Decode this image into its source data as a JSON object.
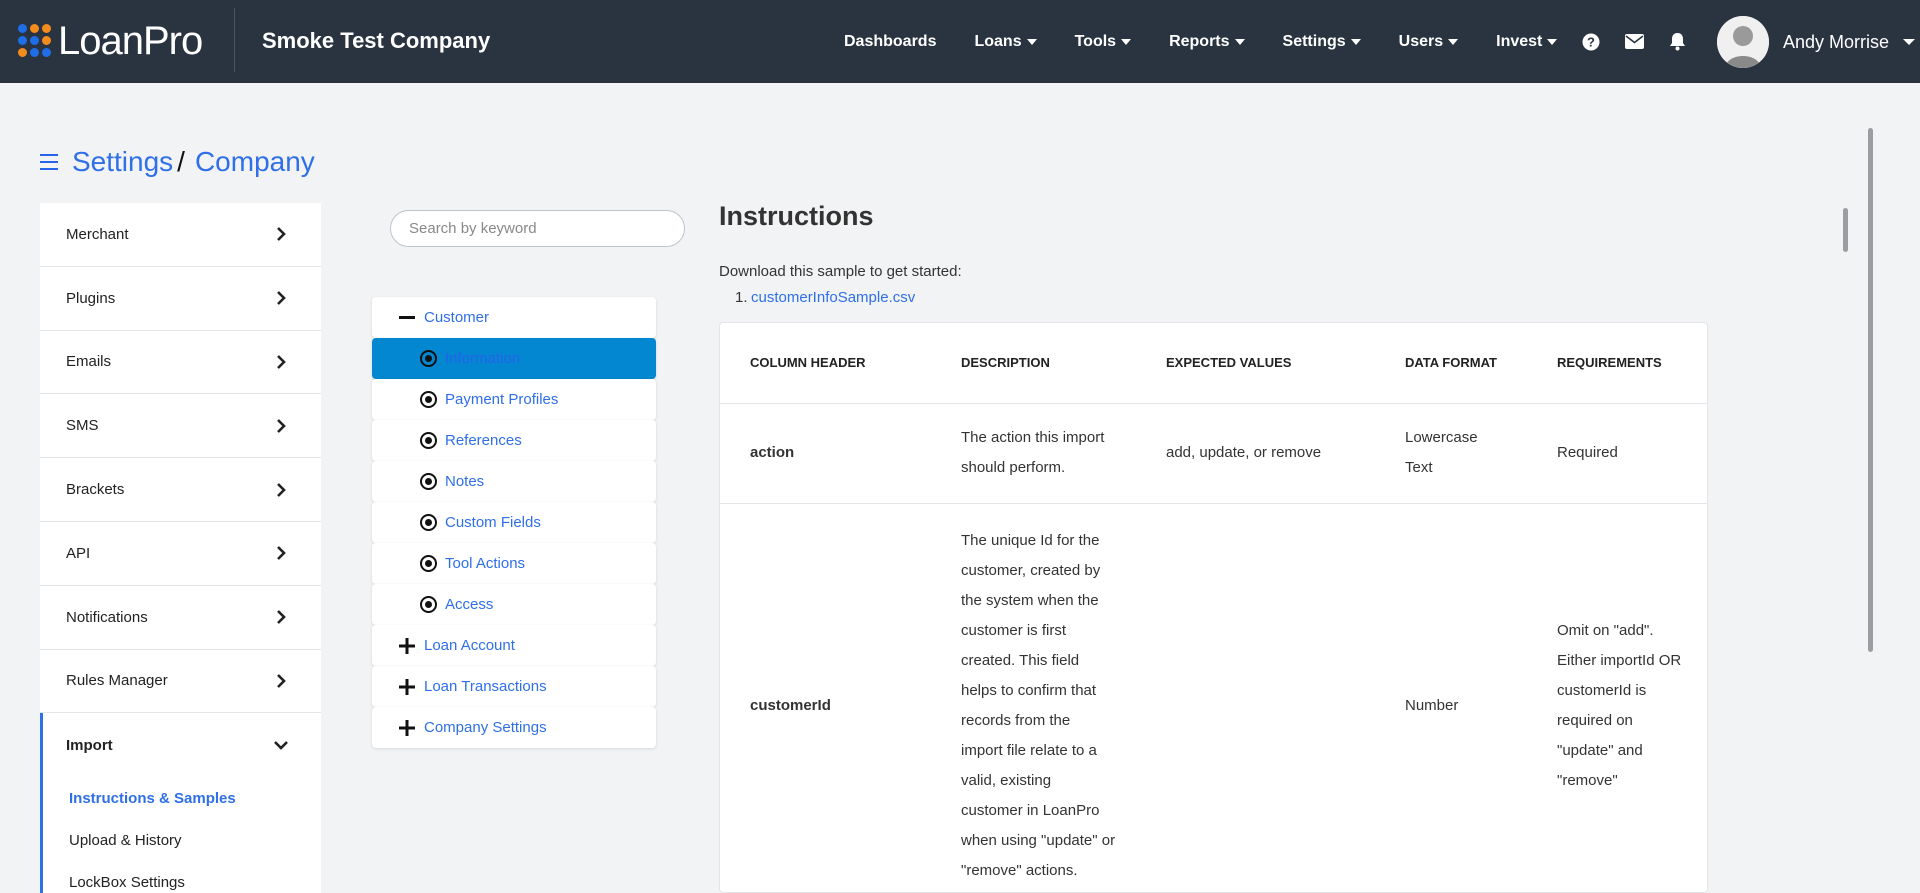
{
  "brand": {
    "logo_text": "LoanPro",
    "dot_colors": [
      "#1f6ee8",
      "#f28c1c",
      "#f28c1c",
      "#1f6ee8",
      "#1f6ee8",
      "#f28c1c",
      "#f28c1c",
      "#1f6ee8",
      "#1f6ee8"
    ],
    "company": "Smoke Test Company"
  },
  "nav": {
    "items": [
      {
        "label": "Dashboards",
        "dropdown": false
      },
      {
        "label": "Loans",
        "dropdown": true
      },
      {
        "label": "Tools",
        "dropdown": true
      },
      {
        "label": "Reports",
        "dropdown": true
      },
      {
        "label": "Settings",
        "dropdown": true
      },
      {
        "label": "Users",
        "dropdown": true
      },
      {
        "label": "Invest",
        "dropdown": true
      }
    ],
    "icons": [
      "help-icon",
      "mail-icon",
      "bell-icon"
    ],
    "user_name": "Andy Morrise"
  },
  "breadcrumb": {
    "root": "Settings",
    "separator": "/",
    "current": "Company"
  },
  "sidebar": {
    "items": [
      "Merchant",
      "Plugins",
      "Emails",
      "SMS",
      "Brackets",
      "API",
      "Notifications",
      "Rules Manager"
    ],
    "open_item": "Import",
    "sub_items": [
      "Instructions & Samples",
      "Upload & History",
      "LockBox Settings"
    ]
  },
  "search": {
    "placeholder": "Search by keyword"
  },
  "tree": {
    "customer": "Customer",
    "children": [
      "Information",
      "Payment Profiles",
      "References",
      "Notes",
      "Custom Fields",
      "Tool Actions",
      "Access"
    ],
    "collapsed": [
      "Loan Account",
      "Loan Transactions",
      "Company Settings"
    ]
  },
  "instructions": {
    "title": "Instructions",
    "intro": "Download this sample to get started:",
    "link_number": "1.",
    "link": "customerInfoSample.csv"
  },
  "table": {
    "headers": [
      "COLUMN HEADER",
      "DESCRIPTION",
      "EXPECTED VALUES",
      "DATA FORMAT",
      "REQUIREMENTS"
    ],
    "rows": [
      {
        "field": "action",
        "description": "The action this import should perform.",
        "expected": "add, update, or remove",
        "format": "Lowercase Text",
        "requirements": "Required"
      },
      {
        "field": "customerId",
        "description": "The unique Id for the customer, created by the system when the customer is first created. This field helps to confirm that records from the import file relate to a valid, existing customer in LoanPro when using \"update\" or \"remove\" actions.",
        "expected": "",
        "format": "Number",
        "requirements": "Omit on \"add\". Either importId OR customerId is required on \"update\" and \"remove\""
      }
    ]
  },
  "colors": {
    "topbar": "#2a3441",
    "accent": "#2f6fe8",
    "selected_node": "#0287d0"
  }
}
